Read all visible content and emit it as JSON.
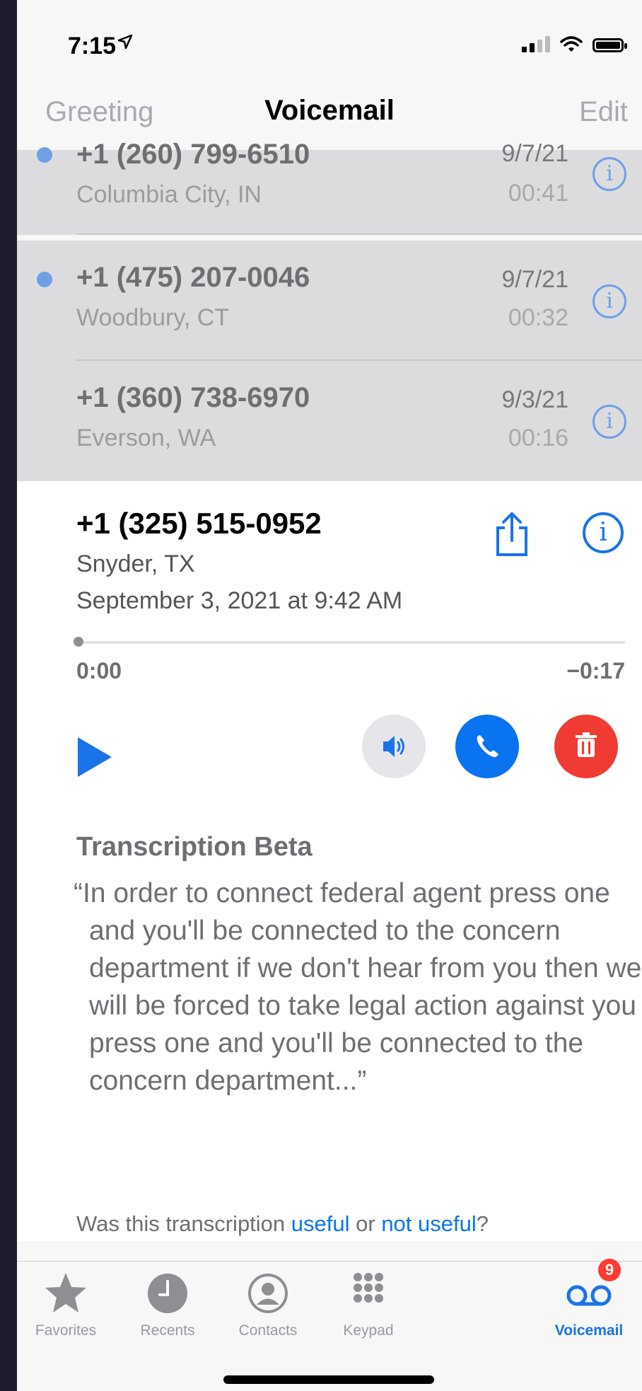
{
  "status": {
    "time": "7:15"
  },
  "nav": {
    "left": "Greeting",
    "title": "Voicemail",
    "right": "Edit"
  },
  "voicemails": [
    {
      "number": "+1 (260) 799-6510",
      "location": "Columbia City, IN",
      "date": "9/7/21",
      "duration": "00:41",
      "unread": true
    },
    {
      "number": "+1 (475) 207-0046",
      "location": "Woodbury, CT",
      "date": "9/7/21",
      "duration": "00:32",
      "unread": true
    },
    {
      "number": "+1 (360) 738-6970",
      "location": "Everson, WA",
      "date": "9/3/21",
      "duration": "00:16",
      "unread": false
    }
  ],
  "detail": {
    "number": "+1 (325) 515-0952",
    "location": "Snyder, TX",
    "date": "September 3, 2021 at 9:42 AM",
    "elapsed": "0:00",
    "remaining": "−0:17",
    "progress": 0,
    "transcription_heading": "Transcription Beta",
    "transcription": "“In order to connect federal agent press one and you'll be connected to the concern department if we don't hear from you then we will be forced to take legal action against you press one and you'll be connected to the concern department...”",
    "useful_prefix": "Was this transcription ",
    "useful_link": "useful",
    "useful_or": " or ",
    "not_useful_link": "not useful",
    "useful_suffix": "?"
  },
  "tabs": [
    {
      "label": "Favorites",
      "icon": "star-icon"
    },
    {
      "label": "Recents",
      "icon": "clock-icon"
    },
    {
      "label": "Contacts",
      "icon": "person-circle-icon"
    },
    {
      "label": "Keypad",
      "icon": "keypad-icon"
    },
    {
      "label": "Voicemail",
      "icon": "voicemail-icon",
      "badge": "9",
      "active": true
    }
  ],
  "colors": {
    "accent": "#1a73e8",
    "delete": "#f03b33",
    "unread_dot": "#6f9fe6"
  }
}
